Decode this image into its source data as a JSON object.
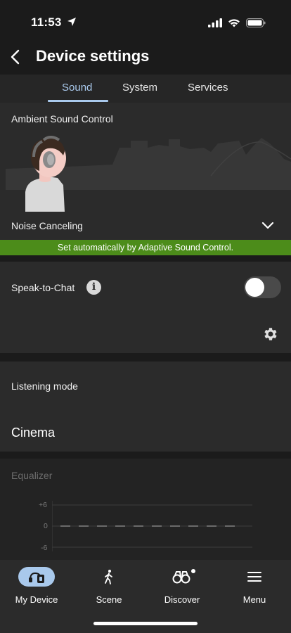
{
  "status_bar": {
    "time": "11:53"
  },
  "header": {
    "title": "Device settings"
  },
  "tabs": [
    {
      "label": "Sound",
      "active": true
    },
    {
      "label": "System",
      "active": false
    },
    {
      "label": "Services",
      "active": false
    }
  ],
  "ambient": {
    "section_title": "Ambient Sound Control",
    "mode": "Noise Canceling",
    "banner": "Set automatically by Adaptive Sound Control."
  },
  "speak_to_chat": {
    "label": "Speak-to-Chat",
    "enabled": false
  },
  "listening_mode": {
    "label": "Listening mode",
    "value": "Cinema"
  },
  "equalizer": {
    "label": "Equalizer",
    "ticks": [
      "+6",
      "0",
      "-6"
    ]
  },
  "bottom_nav": [
    {
      "label": "My Device",
      "active": true
    },
    {
      "label": "Scene",
      "active": false
    },
    {
      "label": "Discover",
      "active": false
    },
    {
      "label": "Menu",
      "active": false
    }
  ],
  "colors": {
    "accent": "#a9c9ec",
    "banner": "#4c8c1a"
  }
}
